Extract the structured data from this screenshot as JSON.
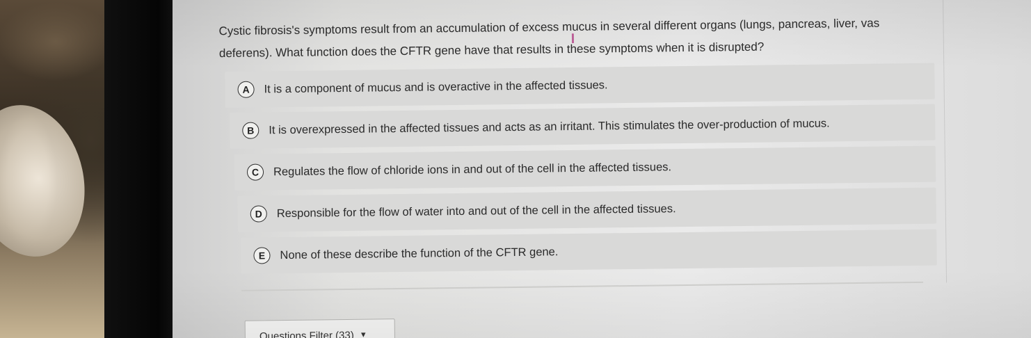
{
  "question": {
    "text_line1": "Cystic fibrosis's symptoms result from an accumulation of excess mucus in several different organs (lungs, pancreas, liver, vas",
    "text_line2": "deferens). What function does the CFTR gene have that results in these symptoms when it is disrupted?"
  },
  "options": [
    {
      "letter": "A",
      "text": "It is a component of mucus and is overactive in the affected tissues."
    },
    {
      "letter": "B",
      "text": "It is overexpressed in the affected tissues and acts as an irritant. This stimulates the over-production of mucus."
    },
    {
      "letter": "C",
      "text": "Regulates the flow of chloride ions in and out of the cell in the affected tissues."
    },
    {
      "letter": "D",
      "text": "Responsible for the flow of water into and out of the cell in the affected tissues."
    },
    {
      "letter": "E",
      "text": "None of these describe the function of the CFTR gene."
    }
  ],
  "filter": {
    "label": "Questions Filter (33)",
    "arrow": "▼"
  },
  "cursor_glyph": "I"
}
